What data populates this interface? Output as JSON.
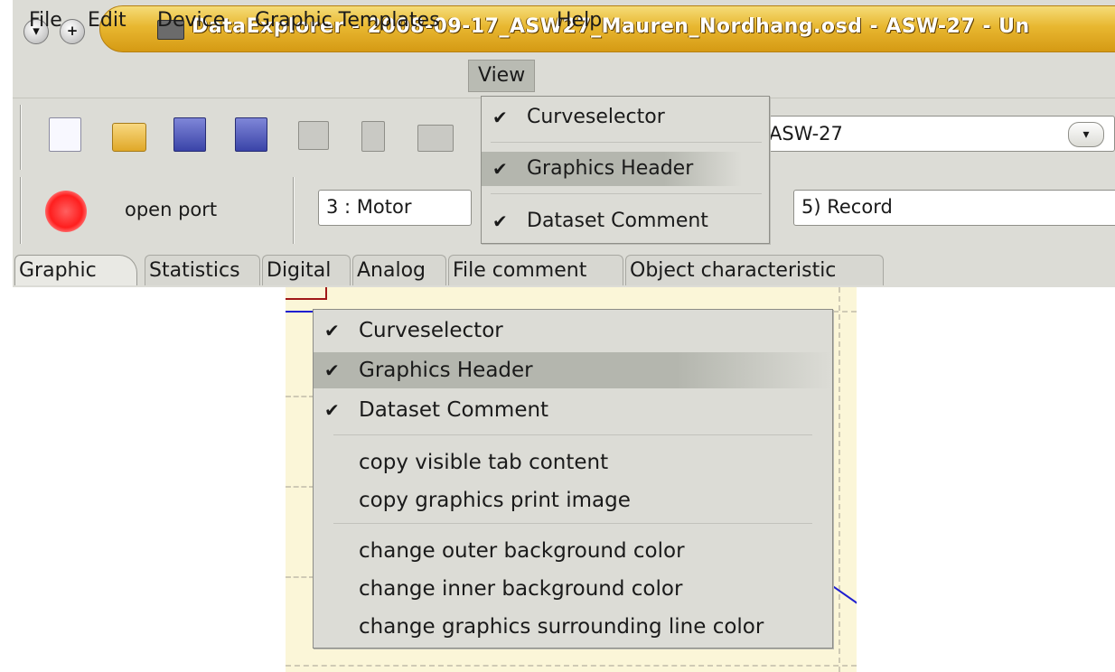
{
  "window": {
    "title": "DataExplorer  -  2008-09-17_ASW27_Mauren_Nordhang.osd  -  ASW-27  -  Un"
  },
  "menubar": {
    "items": [
      "File",
      "Edit",
      "Device",
      "Graphic Templates",
      "View",
      "Help"
    ],
    "active": "View"
  },
  "toolbar": {
    "device_combo": "ASW-27",
    "channel_combo": "3 : Motor",
    "record_combo": "5) Record",
    "open_port": "open port"
  },
  "tabs": {
    "items": [
      "Graphic",
      "Statistics",
      "Digital",
      "Analog",
      "File comment",
      "Object characteristic"
    ],
    "selected": "Graphic"
  },
  "view_menu": {
    "items": [
      {
        "label": "Curveselector",
        "checked": true
      },
      {
        "label": "Graphics Header",
        "checked": true
      },
      {
        "label": "Dataset Comment",
        "checked": true
      }
    ]
  },
  "context_menu": {
    "check_items": [
      {
        "label": "Curveselector",
        "checked": true
      },
      {
        "label": "Graphics Header",
        "checked": true
      },
      {
        "label": "Dataset Comment",
        "checked": true
      }
    ],
    "copy_items": [
      "copy visible tab content",
      "copy graphics print image"
    ],
    "color_items": [
      "change outer background color",
      "change inner background color",
      "change graphics surrounding line color"
    ]
  },
  "glyphs": {
    "check": "✔",
    "minimize": "▾",
    "maximize": "+",
    "dropdown": "▾"
  },
  "colors": {
    "title_gold": "#e8b730",
    "record_red": "#ff1e1e",
    "graph_bg": "#fbf6d8",
    "menu_highlight": "#b9bbb3"
  }
}
